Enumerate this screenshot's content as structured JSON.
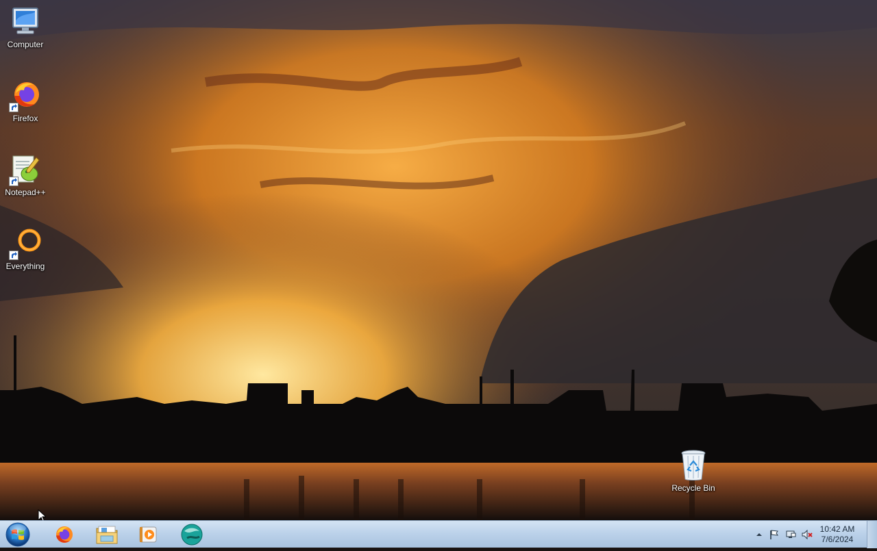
{
  "desktop": {
    "icons": [
      {
        "label": "Computer",
        "icon": "computer-icon"
      },
      {
        "label": "Firefox",
        "icon": "firefox-icon"
      },
      {
        "label": "Notepad++",
        "icon": "notepad-plus-plus-icon"
      },
      {
        "label": "Everything",
        "icon": "everything-search-icon"
      },
      {
        "label": "Recycle Bin",
        "icon": "recycle-bin-icon"
      }
    ]
  },
  "taskbar": {
    "start": {
      "icon": "windows-start-orb-icon"
    },
    "pinned": [
      {
        "icon": "firefox-icon"
      },
      {
        "icon": "file-explorer-icon"
      },
      {
        "icon": "media-player-icon"
      },
      {
        "icon": "app-globe-icon"
      }
    ],
    "tray": {
      "icons": [
        "show-hidden-icons-arrow",
        "action-center-flag-icon",
        "network-icon",
        "volume-muted-icon"
      ],
      "time": "10:42 AM",
      "date": "7/6/2024"
    }
  },
  "colors": {
    "taskbar": "#bcd2ea",
    "sky_glow": "#f2a22e",
    "sky_dark": "#2e2a2e"
  }
}
